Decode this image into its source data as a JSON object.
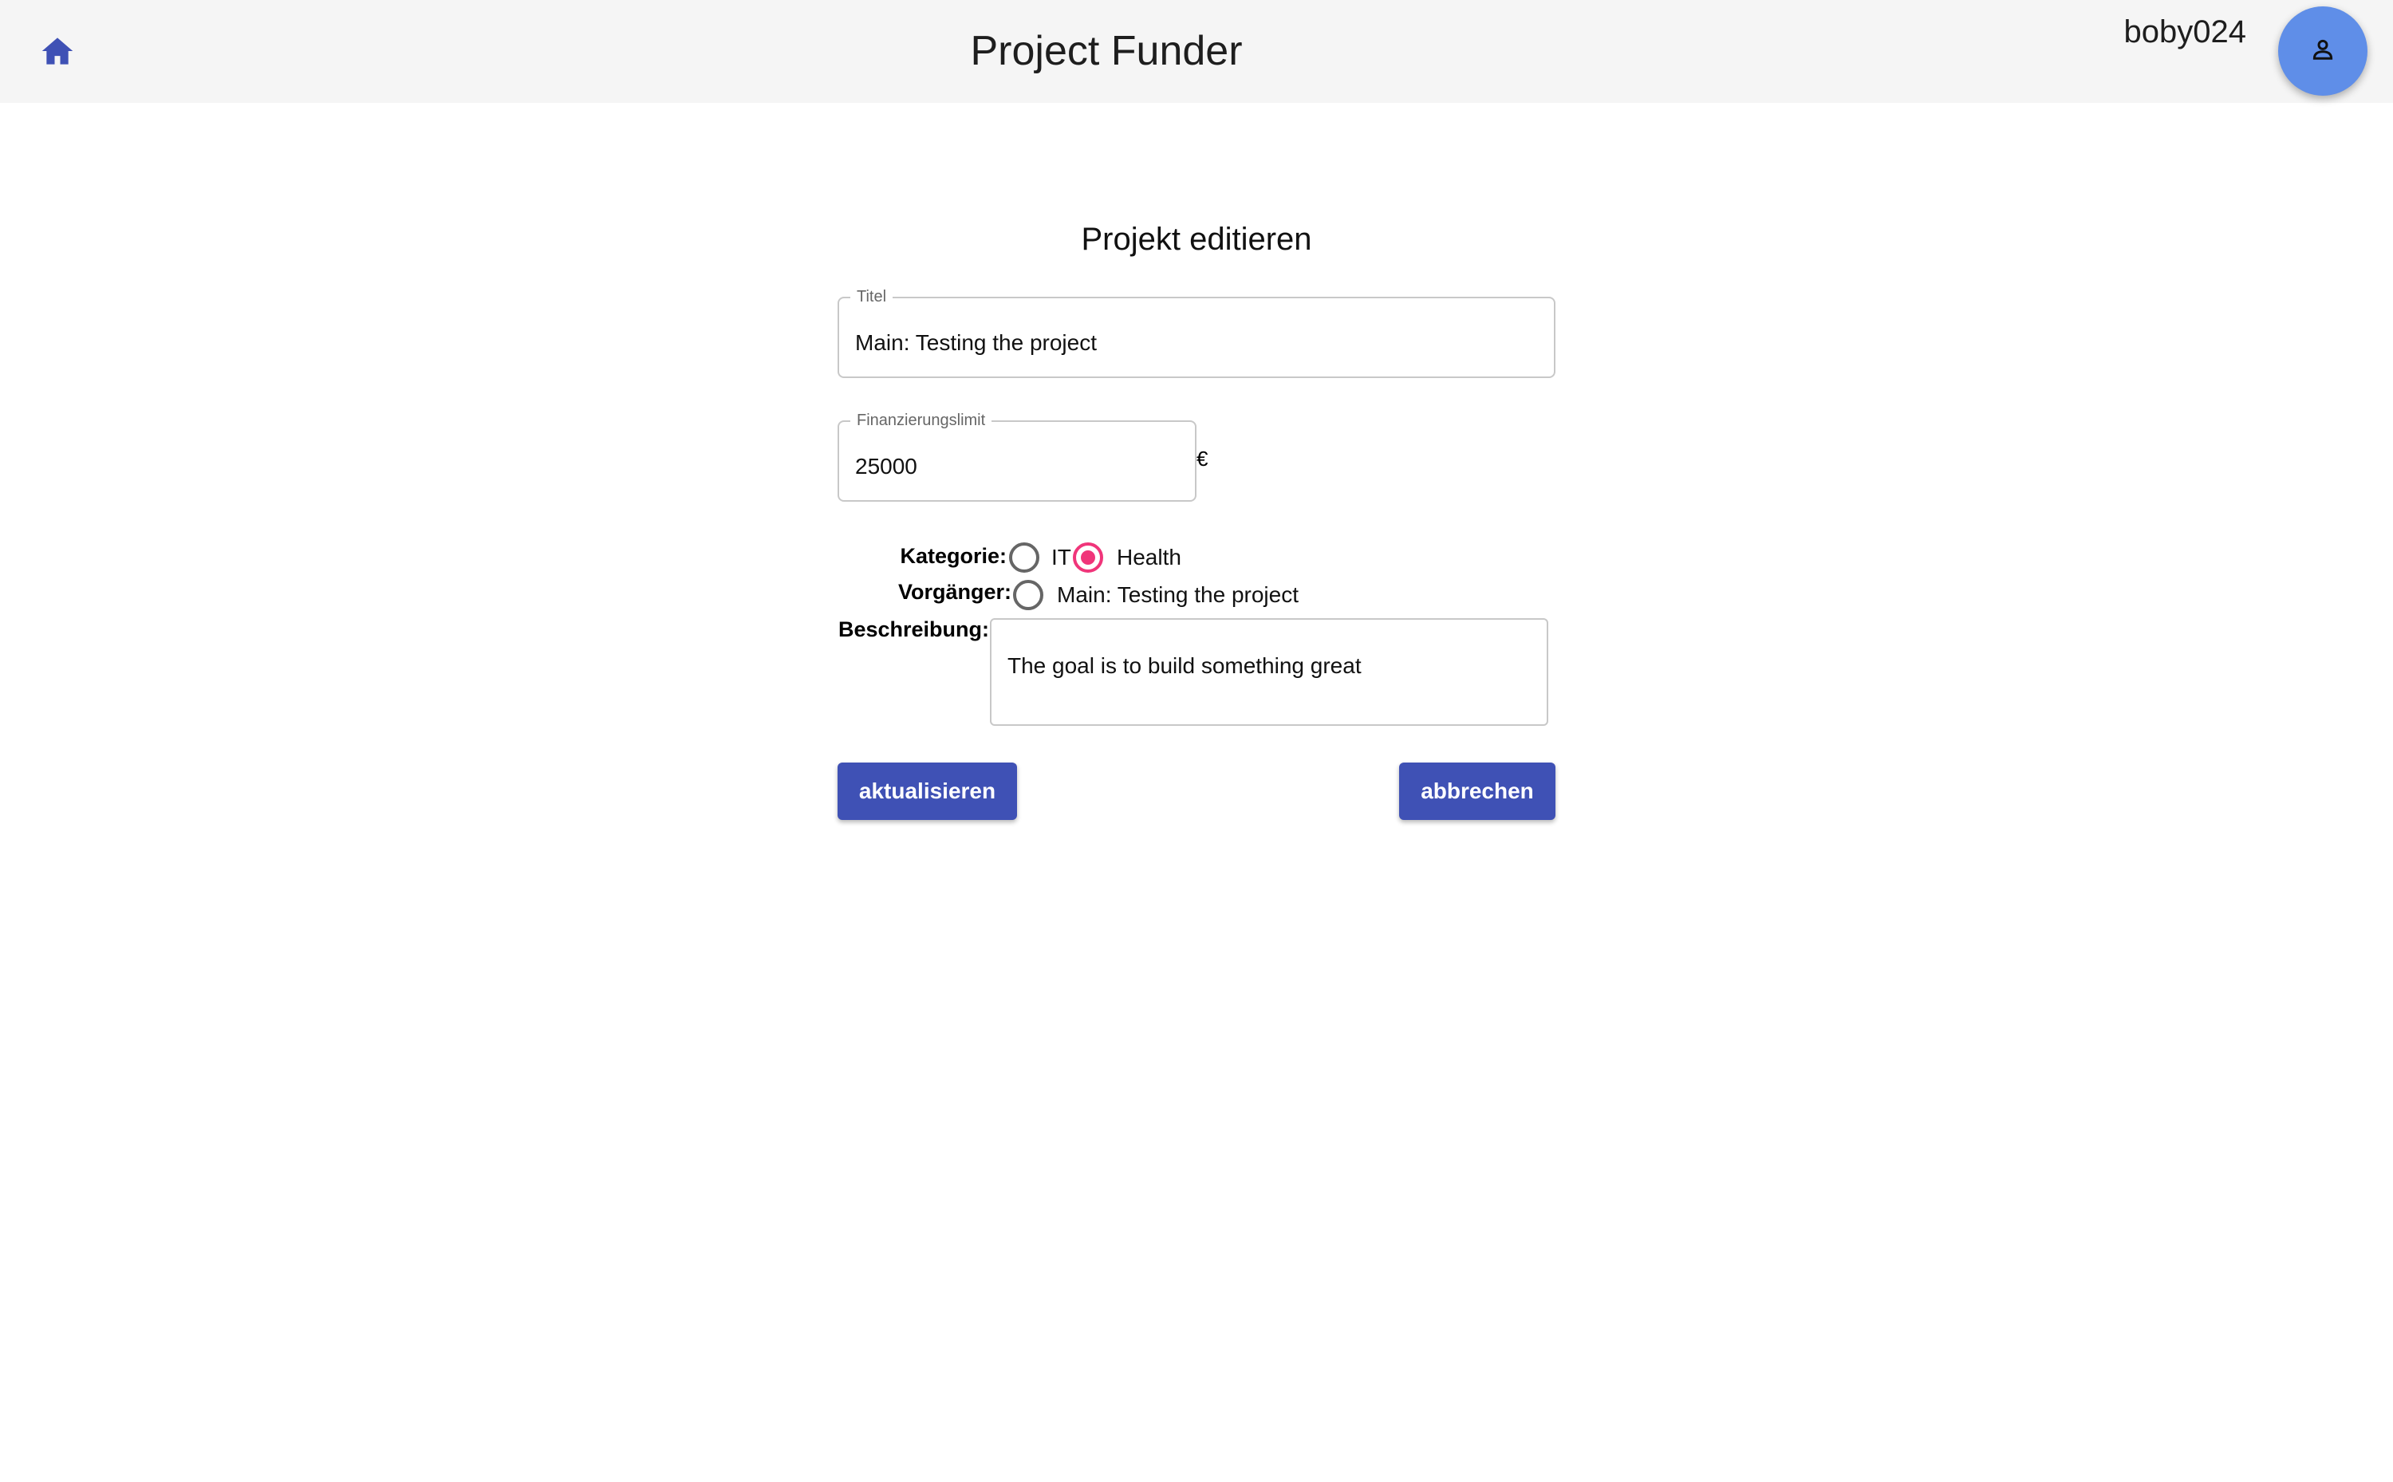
{
  "header": {
    "app_title": "Project Funder",
    "username": "boby024",
    "home_icon": "home-icon",
    "avatar_icon": "person-icon"
  },
  "form": {
    "title": "Projekt editieren",
    "title_field": {
      "label": "Titel",
      "value": "Main: Testing the project"
    },
    "limit_field": {
      "label": "Finanzierungslimit",
      "value": "25000",
      "currency": "€"
    },
    "kategorie": {
      "label": "Kategorie:",
      "options": [
        {
          "label": "IT",
          "selected": false
        },
        {
          "label": "Health",
          "selected": true
        }
      ]
    },
    "vorgaenger": {
      "label": "Vorgänger:",
      "options": [
        {
          "label": "Main: Testing the project",
          "selected": false
        }
      ]
    },
    "beschreibung": {
      "label": "Beschreibung:",
      "value": "The goal is to build something great"
    },
    "buttons": {
      "update": "aktualisieren",
      "cancel": "abbrechen"
    }
  },
  "colors": {
    "primary": "#3f51b5",
    "accent": "#f0357a",
    "avatar": "#5f8ee8",
    "header_bg": "#f5f5f5"
  }
}
